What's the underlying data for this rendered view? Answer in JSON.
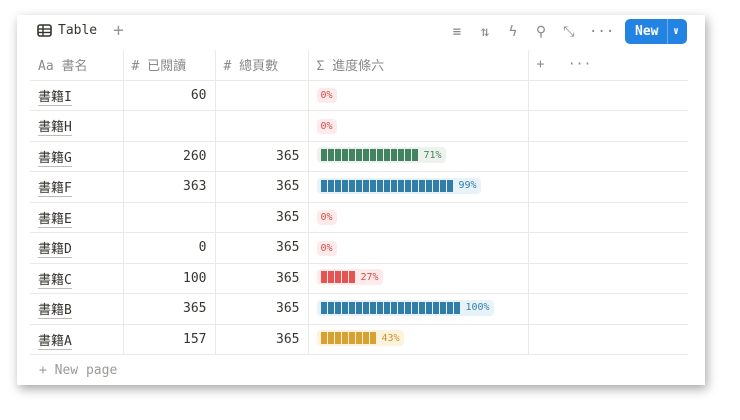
{
  "toolbar": {
    "view_label": "Table",
    "add_view": "+",
    "new_label": "New",
    "icons": [
      "filter-icon",
      "sort-icon",
      "lightning-icon",
      "search-icon",
      "expand-icon",
      "more-icon"
    ]
  },
  "columns": {
    "name": "書名",
    "name_icon": "Aa",
    "read": "已閱讀",
    "total": "總頁數",
    "progress": "進度條六",
    "num_icon": "#",
    "formula_icon": "Σ",
    "add": "+",
    "more": "···"
  },
  "rows": [
    {
      "name": "書籍I",
      "read": "60",
      "total": "",
      "pct": 0,
      "label": "0%",
      "color": "red"
    },
    {
      "name": "書籍H",
      "read": "",
      "total": "",
      "pct": 0,
      "label": "0%",
      "color": "red"
    },
    {
      "name": "書籍G",
      "read": "260",
      "total": "365",
      "pct": 71,
      "label": "71%",
      "color": "green"
    },
    {
      "name": "書籍F",
      "read": "363",
      "total": "365",
      "pct": 99,
      "label": "99%",
      "color": "blue"
    },
    {
      "name": "書籍E",
      "read": "",
      "total": "365",
      "pct": 0,
      "label": "0%",
      "color": "red"
    },
    {
      "name": "書籍D",
      "read": "0",
      "total": "365",
      "pct": 0,
      "label": "0%",
      "color": "red"
    },
    {
      "name": "書籍C",
      "read": "100",
      "total": "365",
      "pct": 27,
      "label": "27%",
      "color": "red"
    },
    {
      "name": "書籍B",
      "read": "365",
      "total": "365",
      "pct": 100,
      "label": "100%",
      "color": "blue"
    },
    {
      "name": "書籍A",
      "read": "157",
      "total": "365",
      "pct": 43,
      "label": "43%",
      "color": "orange"
    }
  ],
  "colors": {
    "red": {
      "bar": "#e55353",
      "bg": "#fdebec",
      "text": "#d44c47"
    },
    "green": {
      "bar": "#448361",
      "bg": "#edf3ec",
      "text": "#448361"
    },
    "blue": {
      "bar": "#337ea9",
      "bg": "#e7f3f8",
      "text": "#337ea9"
    },
    "orange": {
      "bar": "#d9a032",
      "bg": "#fbf3db",
      "text": "#cb912f"
    },
    "accent": "#2383e2"
  },
  "new_page": "+ New page"
}
